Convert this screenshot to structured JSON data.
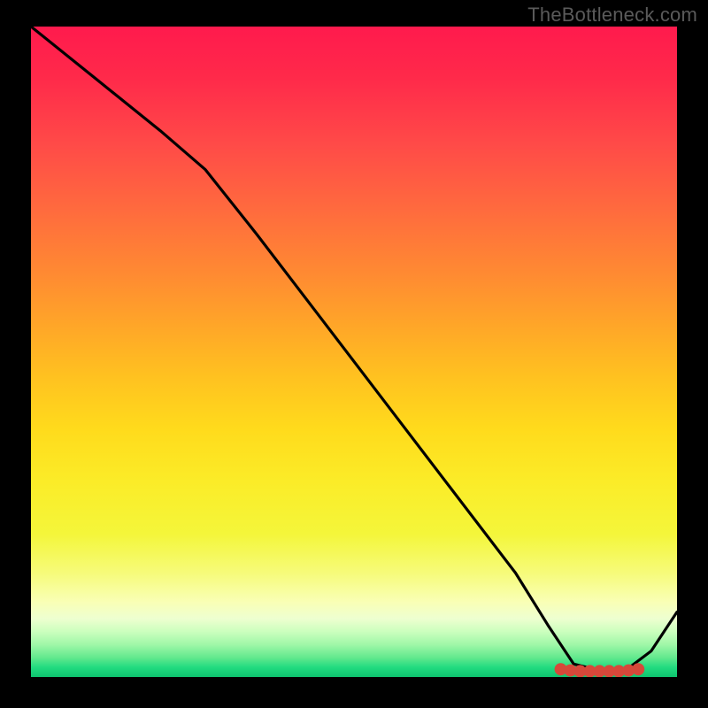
{
  "watermark": "TheBottleneck.com",
  "colors": {
    "background": "#000000",
    "curve": "#000000",
    "marker": "#d6483a"
  },
  "chart_data": {
    "type": "line",
    "title": "",
    "xlabel": "",
    "ylabel": "",
    "xlim": [
      0,
      100
    ],
    "ylim": [
      0,
      100
    ],
    "series": [
      {
        "name": "bottleneck-curve",
        "x": [
          0,
          10,
          20,
          27,
          35,
          45,
          55,
          65,
          75,
          80,
          84,
          88,
          92,
          96,
          100
        ],
        "y": [
          100,
          92,
          84,
          78,
          68,
          55,
          42,
          29,
          16,
          8,
          2,
          1,
          1,
          4,
          10
        ]
      }
    ],
    "markers": {
      "name": "optimal-band",
      "x": [
        82,
        83.5,
        85,
        86.5,
        88,
        89.5,
        91,
        92.5,
        94
      ],
      "y": [
        1.2,
        1.0,
        0.9,
        0.9,
        0.9,
        0.9,
        0.9,
        1.0,
        1.2
      ],
      "radius": 7
    },
    "background_gradient": {
      "top": "#ff1a4d",
      "mid": "#ffe020",
      "bottom": "#0dc46f"
    }
  }
}
